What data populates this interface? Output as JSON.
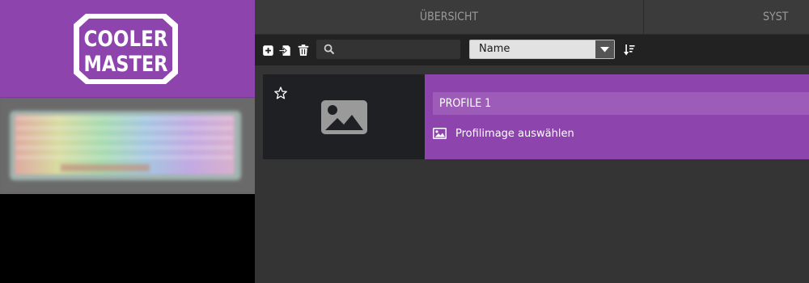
{
  "brand": {
    "logo_line1": "COOLER",
    "logo_line2": "MASTER",
    "accent": "#8e44ad"
  },
  "tabs": [
    {
      "label": "ÜBERSICHT"
    },
    {
      "label": "SYST"
    }
  ],
  "toolbar": {
    "icons": [
      "add-profile-icon",
      "import-profile-icon",
      "delete-profile-icon",
      "search-icon",
      "sort-order-icon"
    ],
    "search_value": "",
    "sort_selected": "Name"
  },
  "profiles": [
    {
      "name": "PROFILE 1",
      "choose_image_label": "Profilimage auswählen"
    }
  ]
}
